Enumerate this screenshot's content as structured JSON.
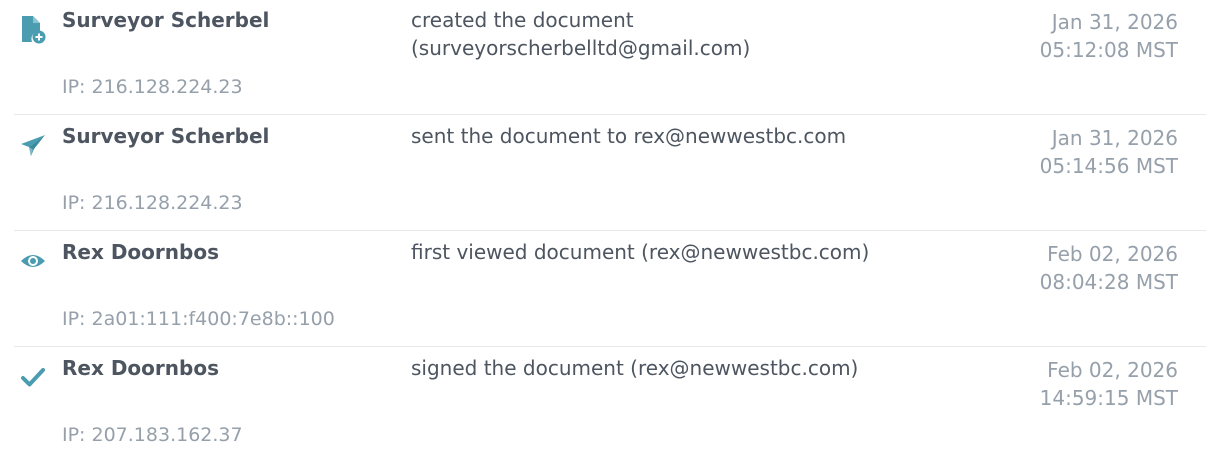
{
  "accent_color": "#4a9cb0",
  "events": [
    {
      "icon": "document-add-icon",
      "actor": "Surveyor Scherbel",
      "action_lines": [
        "created the document",
        "(surveyorscherbelltd@gmail.com)"
      ],
      "date": "Jan 31, 2026",
      "time": "05:12:08 MST",
      "ip": "IP: 216.128.224.23"
    },
    {
      "icon": "paper-plane-icon",
      "actor": "Surveyor Scherbel",
      "action_lines": [
        "sent the document to rex@newwestbc.com"
      ],
      "date": "Jan 31, 2026",
      "time": "05:14:56 MST",
      "ip": "IP: 216.128.224.23"
    },
    {
      "icon": "eye-icon",
      "actor": "Rex Doornbos",
      "action_lines": [
        "first viewed document (rex@newwestbc.com)"
      ],
      "date": "Feb 02, 2026",
      "time": "08:04:28 MST",
      "ip": "IP: 2a01:111:f400:7e8b::100"
    },
    {
      "icon": "checkmark-icon",
      "actor": "Rex Doornbos",
      "action_lines": [
        "signed the document (rex@newwestbc.com)"
      ],
      "date": "Feb 02, 2026",
      "time": "14:59:15 MST",
      "ip": "IP: 207.183.162.37"
    }
  ]
}
